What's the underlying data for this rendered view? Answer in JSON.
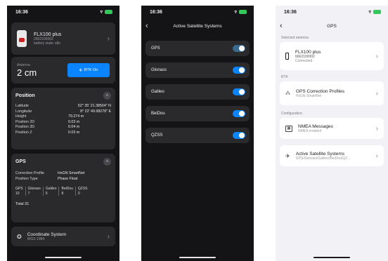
{
  "phone1": {
    "time": "16:36",
    "device": {
      "name": "FLX100 plus",
      "serial": "2662100002",
      "status": "battery state: idle"
    },
    "antenna": {
      "label": "Antenna",
      "value": "2 cm"
    },
    "button_label": "RTK On",
    "position": {
      "title": "Position",
      "rows": [
        {
          "k": "Latitude",
          "v": "52° 35' 21.38504\" N"
        },
        {
          "k": "Longitude",
          "v": "8° 22' 49.98278\" E"
        },
        {
          "k": "Height",
          "v": "79.274 m"
        },
        {
          "k": "Position 2D",
          "v": "0.03 m"
        },
        {
          "k": "Position 3D",
          "v": "0.04 m"
        },
        {
          "k": "Position Z",
          "v": "0.03 m"
        }
      ]
    },
    "gps": {
      "title": "GPS",
      "profile_label": "Correction Profile",
      "profile_value": "HxGN SmartNet",
      "fix_label": "Position Type",
      "fix_value": "Phase Float",
      "sats": [
        {
          "name": "GPS",
          "n": "10"
        },
        {
          "name": "Glonass",
          "n": "7"
        },
        {
          "name": "Galileo",
          "n": "6"
        },
        {
          "name": "BeiDou",
          "n": "8"
        },
        {
          "name": "QZSS",
          "n": "0"
        }
      ],
      "total": "Total 31"
    },
    "coord": {
      "title": "Coordinate System",
      "sub": "WGS 1984"
    }
  },
  "phone2": {
    "time": "16:36",
    "title": "Active Satellite Systems",
    "systems": [
      {
        "name": "GPS",
        "on": false
      },
      {
        "name": "Glonass",
        "on": true
      },
      {
        "name": "Galileo",
        "on": true
      },
      {
        "name": "BeiDou",
        "on": true
      },
      {
        "name": "QZSS",
        "on": true
      }
    ]
  },
  "phone3": {
    "time": "16:36",
    "title": "GPS",
    "selected_header": "Selected antenna",
    "antenna": {
      "name": "FLX100 plus",
      "serial": "6662100002",
      "status": "Connected"
    },
    "rtk_header": "RTK",
    "profile": {
      "name": "GPS Correction Profiles",
      "sub": "HxGN SmartNet"
    },
    "config_header": "Configuration",
    "nmea": {
      "name": "NMEA Messages",
      "sub": "NMEA enabled"
    },
    "satsys": {
      "name": "Active Satellite Systems",
      "sub": "GPS/Glonass/Galileo/BeiDou/QZ..."
    }
  }
}
